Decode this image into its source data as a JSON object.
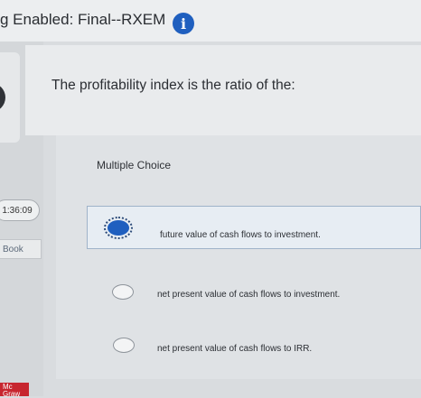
{
  "header": {
    "title": "g Enabled: Final--RXEM",
    "info_icon": "info-icon"
  },
  "sidebar": {
    "timer": "1:36:09",
    "book": "Book",
    "logo": "Mc Graw"
  },
  "question": {
    "text": "The profitability index is the ratio of the:"
  },
  "choices": {
    "label": "Multiple Choice",
    "options": [
      {
        "text": "future value of cash flows to investment.",
        "selected": true
      },
      {
        "text": "net present value of cash flows to investment.",
        "selected": false
      },
      {
        "text": "net present value of cash flows to IRR.",
        "selected": false
      }
    ]
  },
  "colors": {
    "accent": "#1f5fbf",
    "brand_logo": "#c7262f"
  }
}
